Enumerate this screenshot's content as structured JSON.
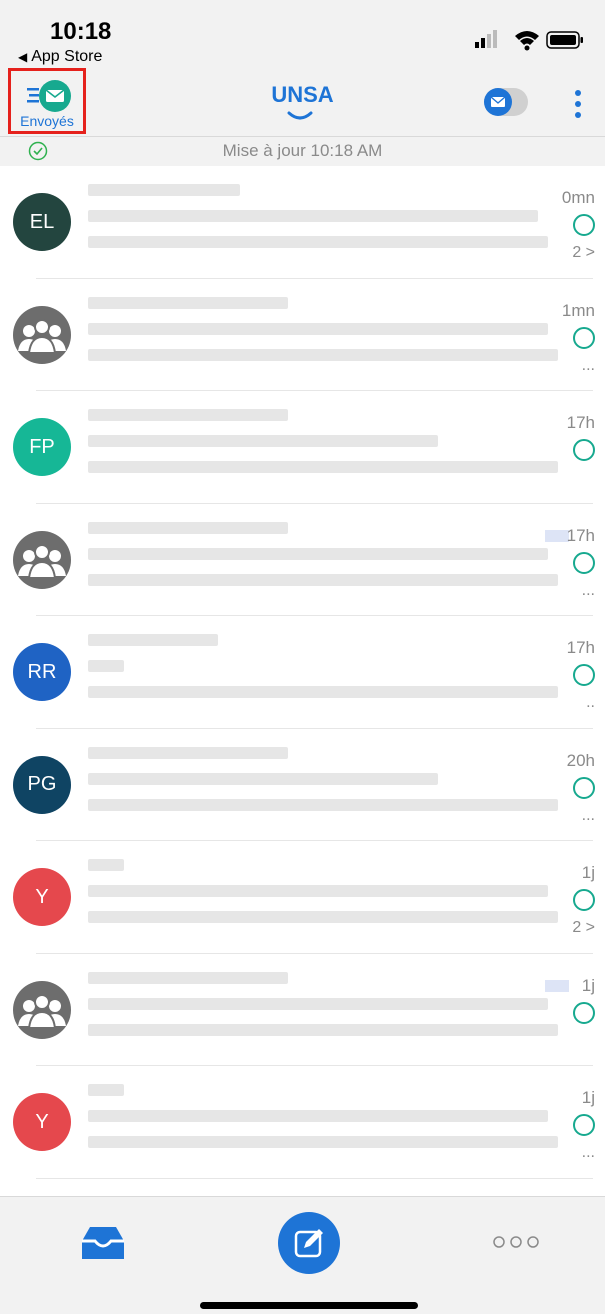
{
  "status_bar": {
    "time": "10:18",
    "back_label": "App Store"
  },
  "header": {
    "sent_label": "Envoyés",
    "title": "UNSA"
  },
  "update": {
    "text": "Mise à jour 10:18 AM"
  },
  "messages": [
    {
      "initials": "EL",
      "avatar_color": "#23453f",
      "group": false,
      "time": "0mn",
      "extra": "2 >"
    },
    {
      "initials": "",
      "avatar_color": "#6d6d6d",
      "group": true,
      "time": "1mn",
      "extra": "..."
    },
    {
      "initials": "FP",
      "avatar_color": "#16b796",
      "group": false,
      "time": "17h",
      "extra": ""
    },
    {
      "initials": "",
      "avatar_color": "#6d6d6d",
      "group": true,
      "time": "17h",
      "extra": "..."
    },
    {
      "initials": "RR",
      "avatar_color": "#1f63c4",
      "group": false,
      "time": "17h",
      "extra": ".."
    },
    {
      "initials": "PG",
      "avatar_color": "#0f4463",
      "group": false,
      "time": "20h",
      "extra": "..."
    },
    {
      "initials": "Y",
      "avatar_color": "#e5484d",
      "group": false,
      "time": "1j",
      "extra": "2 >"
    },
    {
      "initials": "",
      "avatar_color": "#6d6d6d",
      "group": true,
      "time": "1j",
      "extra": ""
    },
    {
      "initials": "Y",
      "avatar_color": "#e5484d",
      "group": false,
      "time": "1j",
      "extra": "..."
    }
  ],
  "colors": {
    "accent": "#1e74d6",
    "status_ring": "#17a98f",
    "highlight_box": "#e5211c"
  }
}
